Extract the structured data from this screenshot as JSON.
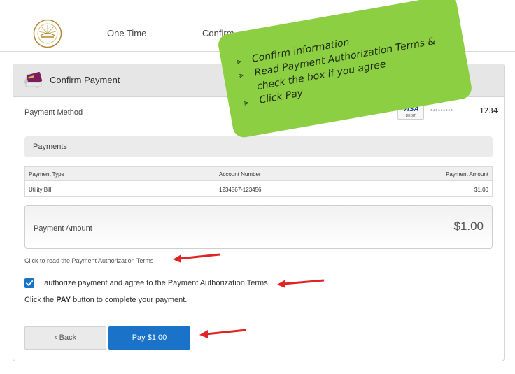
{
  "nav": {
    "tabs": [
      "One Time Payment",
      "Confirm Payment"
    ]
  },
  "panel": {
    "title": "Confirm Payment",
    "payment_method_label": "Payment Method",
    "card": {
      "brand": "VISA",
      "type": "DEBIT",
      "masked": "*********",
      "last4": "1234"
    },
    "payments_header": "Payments",
    "table": {
      "columns": [
        "Payment Type",
        "Account Number",
        "Payment Amount"
      ],
      "rows": [
        {
          "type": "Utility Bill",
          "account": "1234567-123456",
          "amount": "$1.00"
        }
      ]
    },
    "amount": {
      "label": "Payment Amount",
      "value": "$1.00"
    },
    "terms_link": "Click to read the Payment Authorization Terms",
    "authorize": {
      "checked": true,
      "label": "I authorize payment and agree to the Payment Authorization Terms"
    },
    "instruction": {
      "prefix": "Click the ",
      "bold": "PAY",
      "suffix": " button to complete your payment."
    },
    "buttons": {
      "back": "‹ Back",
      "pay": "Pay $1.00"
    }
  },
  "callout": {
    "items": [
      "Confirm information",
      "Read Payment Authorization Terms &",
      "check the box if you agree",
      "Click Pay"
    ],
    "color": "#8ccf43"
  },
  "colors": {
    "primary": "#1a73c9",
    "arrow": "#e02424"
  }
}
